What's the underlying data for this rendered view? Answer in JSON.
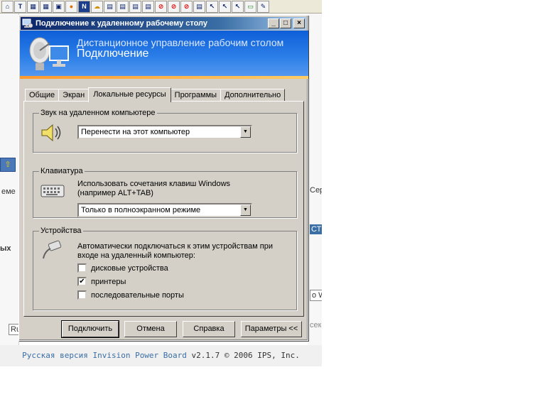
{
  "dialog": {
    "title": "Подключение к удаленному рабочему столу",
    "banner_line1": "Дистанционное управление рабочим столом",
    "banner_line2": "Подключение",
    "tabs": [
      "Общие",
      "Экран",
      "Локальные ресурсы",
      "Программы",
      "Дополнительно"
    ],
    "active_tab": "Локальные ресурсы",
    "sound": {
      "label": "Звук на удаленном компьютере",
      "selected": "Перенести на этот компьютер"
    },
    "keyboard": {
      "label": "Клавиатура",
      "description_line1": "Использовать сочетания клавиш Windows",
      "description_line2": "(например ALT+TAB)",
      "selected": "Только в полноэкранном режиме"
    },
    "devices": {
      "label": "Устройства",
      "description_line1": "Автоматически подключаться к этим устройствам при",
      "description_line2": "входе на удаленный компьютер:",
      "options": [
        {
          "label": "дисковые устройства",
          "checked": false
        },
        {
          "label": "принтеры",
          "checked": true
        },
        {
          "label": "последовательные порты",
          "checked": false
        }
      ]
    },
    "buttons": {
      "connect": "Подключить",
      "cancel": "Отмена",
      "help": "Справка",
      "options": "Параметры <<"
    }
  },
  "background": {
    "fragments": [
      "еме",
      "ых",
      "Ru",
      "Сер",
      "СТР",
      "o W",
      "сек"
    ],
    "footer_text": "Русская версия Invision Power Board",
    "footer_version": "v2.1.7 © 2006  IPS, Inc."
  },
  "colors": {
    "titlebar_start": "#0a246a",
    "banner_blue": "#0e5fd8",
    "dialog_face": "#d4d0c8"
  },
  "toolbar_icons": [
    "home-icon",
    "text-icon",
    "grid-icon",
    "grid-icon",
    "picture-icon",
    "globe-icon",
    "n-icon",
    "cloud-icon",
    "page-icon",
    "page-icon",
    "page-icon",
    "page-icon",
    "no-icon",
    "no-icon",
    "no-icon",
    "page-icon",
    "cursor-icon",
    "cursor-icon",
    "cursor-icon",
    "battery-icon",
    "tool-icon"
  ]
}
